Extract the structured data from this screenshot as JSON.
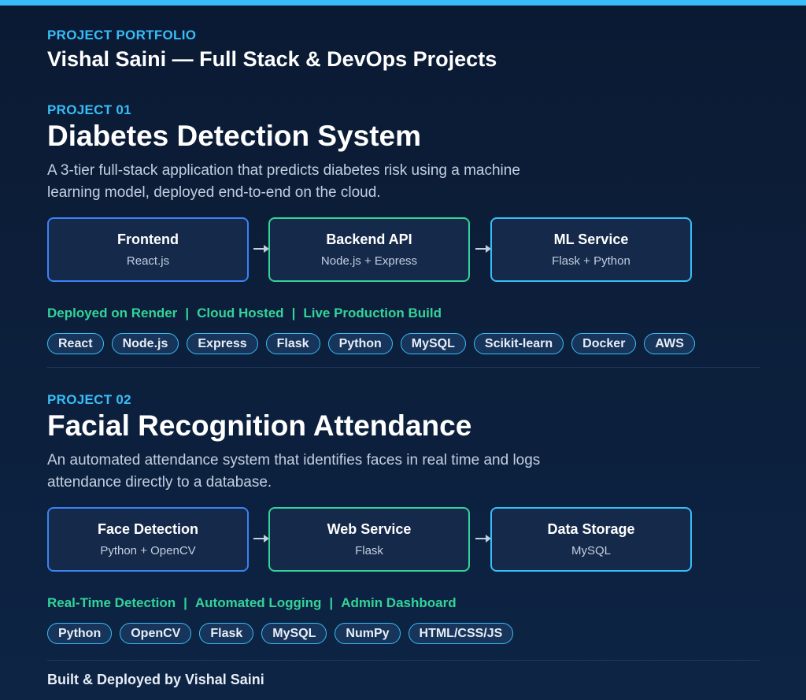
{
  "colors": {
    "accent": "#38bdf8",
    "green": "#34d399",
    "blue": "#3b82f6",
    "background": "#0b1a33"
  },
  "header": {
    "eyebrow": "PROJECT PORTFOLIO",
    "title": "Vishal Saini — Full Stack & DevOps Projects"
  },
  "projects": [
    {
      "eyebrow": "PROJECT 01",
      "title": "Diabetes Detection System",
      "description": "A 3-tier full-stack application that predicts diabetes risk using a machine learning model, deployed end-to-end on the cloud.",
      "flow": [
        {
          "title": "Frontend",
          "subtitle": "React.js"
        },
        {
          "title": "Backend API",
          "subtitle": "Node.js + Express"
        },
        {
          "title": "ML Service",
          "subtitle": "Flask + Python"
        }
      ],
      "highlights": [
        "Deployed on Render",
        "Cloud Hosted",
        "Live Production Build"
      ],
      "highlight_separator": "|",
      "tags": [
        "React",
        "Node.js",
        "Express",
        "Flask",
        "Python",
        "MySQL",
        "Scikit-learn",
        "Docker",
        "AWS"
      ]
    },
    {
      "eyebrow": "PROJECT 02",
      "title": "Facial Recognition Attendance",
      "description": "An automated attendance system that identifies faces in real time and logs attendance directly to a database.",
      "flow": [
        {
          "title": "Face Detection",
          "subtitle": "Python + OpenCV"
        },
        {
          "title": "Web Service",
          "subtitle": "Flask"
        },
        {
          "title": "Data Storage",
          "subtitle": "MySQL"
        }
      ],
      "highlights": [
        "Real-Time Detection",
        "Automated Logging",
        "Admin Dashboard"
      ],
      "highlight_separator": "|",
      "tags": [
        "Python",
        "OpenCV",
        "Flask",
        "MySQL",
        "NumPy",
        "HTML/CSS/JS"
      ]
    }
  ],
  "footer": {
    "text": "Built & Deployed by Vishal Saini"
  }
}
